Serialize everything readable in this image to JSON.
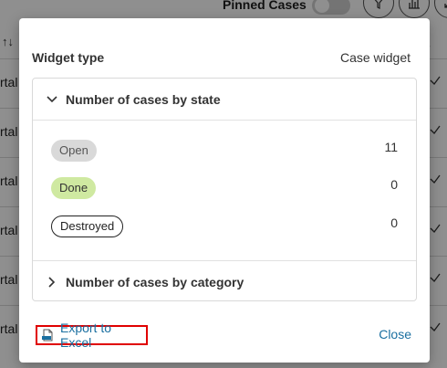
{
  "background": {
    "pinned_cases_label": "Pinned Cases",
    "header_right_text": "s",
    "row_text": [
      "rtal",
      "rtal",
      "rtal",
      "rtal",
      "rtal",
      "rtal"
    ]
  },
  "dialog": {
    "widget_type_label": "Widget type",
    "widget_type_value": "Case widget",
    "sections": [
      {
        "title": "Number of cases by state",
        "expanded": true,
        "states": [
          {
            "label": "Open",
            "count": "11",
            "color": "#d9d9d9"
          },
          {
            "label": "Done",
            "count": "0",
            "color": "#cfe9a1"
          },
          {
            "label": "Destroyed",
            "count": "0",
            "color": "#ffffff"
          }
        ]
      },
      {
        "title": "Number of cases by category",
        "expanded": false
      }
    ],
    "export_label": "Export to Excel",
    "close_label": "Close"
  },
  "colors": {
    "link": "#1a6fa0",
    "highlight_border": "#e00000"
  },
  "icons": {
    "export": "xls-file-icon",
    "expanded": "chevron-down-icon",
    "collapsed": "chevron-right-icon"
  }
}
